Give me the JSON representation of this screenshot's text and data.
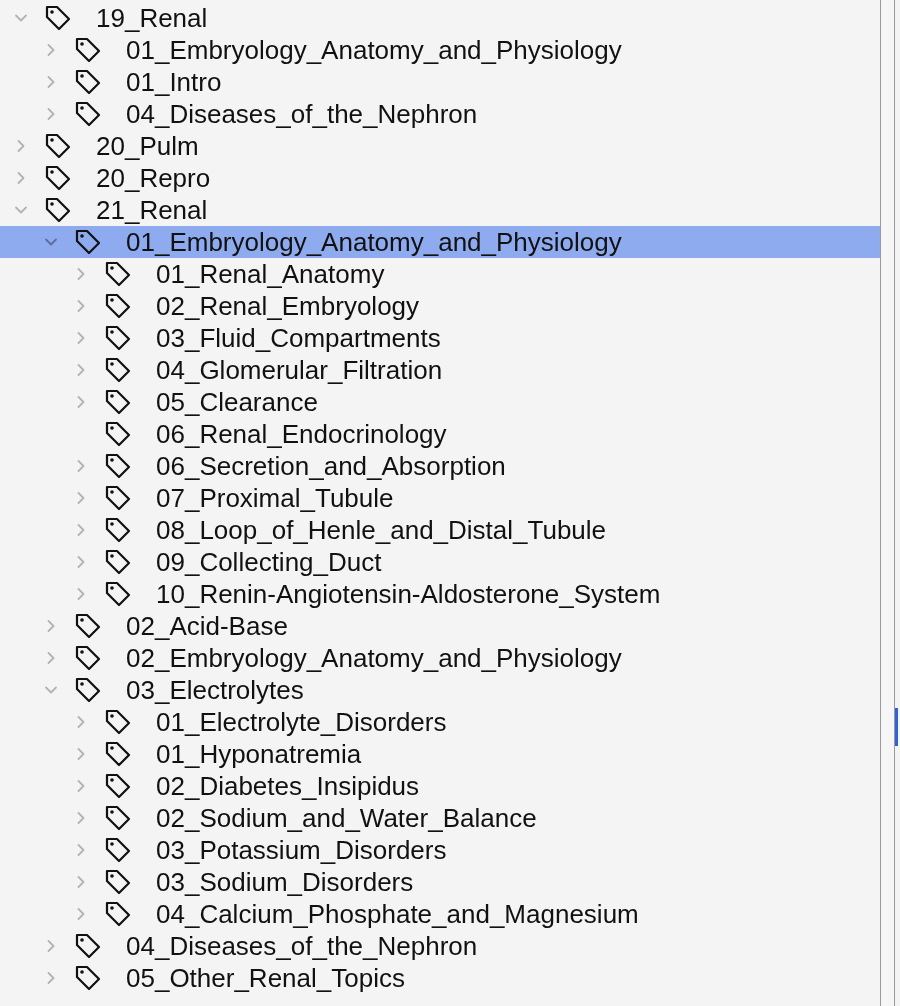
{
  "tree": [
    {
      "label": "19_Renal",
      "kind": "group",
      "expanded": true,
      "selected": false,
      "children": [
        {
          "label": "01_Embryology_Anatomy_and_Physiology",
          "kind": "group",
          "expanded": false,
          "selected": false
        },
        {
          "label": "01_Intro",
          "kind": "group",
          "expanded": false,
          "selected": false
        },
        {
          "label": "04_Diseases_of_the_Nephron",
          "kind": "group",
          "expanded": false,
          "selected": false
        }
      ]
    },
    {
      "label": "20_Pulm",
      "kind": "group",
      "expanded": false,
      "selected": false
    },
    {
      "label": "20_Repro",
      "kind": "group",
      "expanded": false,
      "selected": false
    },
    {
      "label": "21_Renal",
      "kind": "group",
      "expanded": true,
      "selected": false,
      "children": [
        {
          "label": "01_Embryology_Anatomy_and_Physiology",
          "kind": "group",
          "expanded": true,
          "selected": true,
          "children": [
            {
              "label": "01_Renal_Anatomy",
              "kind": "group",
              "expanded": false,
              "selected": false
            },
            {
              "label": "02_Renal_Embryology",
              "kind": "group",
              "expanded": false,
              "selected": false
            },
            {
              "label": "03_Fluid_Compartments",
              "kind": "group",
              "expanded": false,
              "selected": false
            },
            {
              "label": "04_Glomerular_Filtration",
              "kind": "group",
              "expanded": false,
              "selected": false
            },
            {
              "label": "05_Clearance",
              "kind": "group",
              "expanded": false,
              "selected": false
            },
            {
              "label": "06_Renal_Endocrinology",
              "kind": "leaf",
              "selected": false
            },
            {
              "label": "06_Secretion_and_Absorption",
              "kind": "group",
              "expanded": false,
              "selected": false
            },
            {
              "label": "07_Proximal_Tubule",
              "kind": "group",
              "expanded": false,
              "selected": false
            },
            {
              "label": "08_Loop_of_Henle_and_Distal_Tubule",
              "kind": "group",
              "expanded": false,
              "selected": false
            },
            {
              "label": "09_Collecting_Duct",
              "kind": "group",
              "expanded": false,
              "selected": false
            },
            {
              "label": "10_Renin-Angiotensin-Aldosterone_System",
              "kind": "group",
              "expanded": false,
              "selected": false
            }
          ]
        },
        {
          "label": "02_Acid-Base",
          "kind": "group",
          "expanded": false,
          "selected": false
        },
        {
          "label": "02_Embryology_Anatomy_and_Physiology",
          "kind": "group",
          "expanded": false,
          "selected": false
        },
        {
          "label": "03_Electrolytes",
          "kind": "group",
          "expanded": true,
          "selected": false,
          "children": [
            {
              "label": "01_Electrolyte_Disorders",
              "kind": "group",
              "expanded": false,
              "selected": false
            },
            {
              "label": "01_Hyponatremia",
              "kind": "group",
              "expanded": false,
              "selected": false
            },
            {
              "label": "02_Diabetes_Insipidus",
              "kind": "group",
              "expanded": false,
              "selected": false
            },
            {
              "label": "02_Sodium_and_Water_Balance",
              "kind": "group",
              "expanded": false,
              "selected": false
            },
            {
              "label": "03_Potassium_Disorders",
              "kind": "group",
              "expanded": false,
              "selected": false
            },
            {
              "label": "03_Sodium_Disorders",
              "kind": "group",
              "expanded": false,
              "selected": false
            },
            {
              "label": "04_Calcium_Phosphate_and_Magnesium",
              "kind": "group",
              "expanded": false,
              "selected": false
            }
          ]
        },
        {
          "label": "04_Diseases_of_the_Nephron",
          "kind": "group",
          "expanded": false,
          "selected": false
        },
        {
          "label": "05_Other_Renal_Topics",
          "kind": "group",
          "expanded": false,
          "selected": false
        }
      ]
    }
  ]
}
